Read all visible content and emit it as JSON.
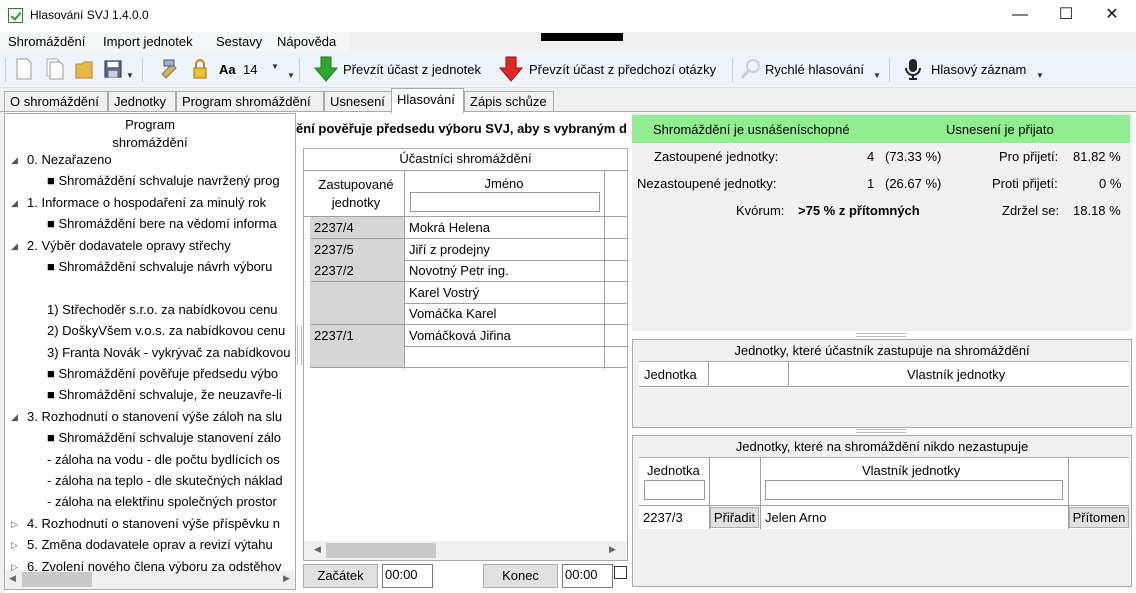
{
  "window": {
    "title": "Hlasování SVJ 1.4.0.0",
    "minimize_glyph": "—",
    "maximize_glyph": "☐",
    "close_glyph": "✕"
  },
  "menu": [
    "Shromáždění",
    "Import jednotek",
    "Sestavy",
    "Nápověda"
  ],
  "toolbar": {
    "font_label": "Aa",
    "font_size": "14",
    "take_over_label": "Převzít účast z jednotek",
    "take_prev_label": "Převzít účast z předchozí otázky",
    "quick_vote_label": "Rychlé hlasování",
    "voice_label": "Hlasový záznam"
  },
  "tabs": [
    "O shromáždění",
    "Jednotky",
    "Program shromáždění",
    "Usnesení",
    "Hlasování",
    "Zápis schůze"
  ],
  "program": {
    "header": "Program shromáždění",
    "items": [
      {
        "text": "0. Nezařazeno",
        "level": 0,
        "toggle": "◢"
      },
      {
        "text": "■ Shromáždění schvaluje navržený prog",
        "level": 1,
        "toggle": ""
      },
      {
        "text": "1. Informace o hospodaření za minulý rok",
        "level": 0,
        "toggle": "◢"
      },
      {
        "text": "■ Shromáždění bere na vědomí informa",
        "level": 1,
        "toggle": ""
      },
      {
        "text": "2. Výběr dodavatele opravy střechy",
        "level": 0,
        "toggle": "◢"
      },
      {
        "text": "■ Shromáždění schvaluje návrh výboru",
        "level": 1,
        "toggle": ""
      },
      {
        "text": "",
        "level": 1,
        "toggle": ""
      },
      {
        "text": "1) Střechoděr s.r.o. za nabídkovou cenu",
        "level": 1,
        "toggle": ""
      },
      {
        "text": "2) DoškyVšem v.o.s. za nabídkovou cenu",
        "level": 1,
        "toggle": ""
      },
      {
        "text": "3) Franta Novák - vykrývač za nabídkovou",
        "level": 1,
        "toggle": ""
      },
      {
        "text": "■ Shromáždění pověřuje předsedu výbo",
        "level": 1,
        "toggle": ""
      },
      {
        "text": "■ Shromáždění schvaluje, že neuzavře-li",
        "level": 1,
        "toggle": ""
      },
      {
        "text": "3. Rozhodnutí o stanovení výše záloh na slu",
        "level": 0,
        "toggle": "◢"
      },
      {
        "text": "■ Shromáždění schvaluje stanovení zálo",
        "level": 1,
        "toggle": ""
      },
      {
        "text": "- záloha na vodu - dle počtu bydlících os",
        "level": 1,
        "toggle": ""
      },
      {
        "text": "- záloha na teplo - dle skutečných náklad",
        "level": 1,
        "toggle": ""
      },
      {
        "text": "- záloha na elektřinu společných prostor",
        "level": 1,
        "toggle": ""
      },
      {
        "text": "4. Rozhodnutí o stanovení výše příspěvku n",
        "level": 0,
        "toggle": "▷"
      },
      {
        "text": "5. Změna dodavatele oprav a revizí výtahu",
        "level": 0,
        "toggle": "▷"
      },
      {
        "text": "6. Zvolení nového člena výboru za odstěhov",
        "level": 0,
        "toggle": "▷"
      }
    ]
  },
  "question_text": "ění pověřuje předsedu výboru SVJ, aby s vybraným d",
  "participants": {
    "title": "Účastníci shromáždění",
    "col_units": "Zastupované jednotky",
    "col_name": "Jméno",
    "rows": [
      {
        "unit": "2237/4",
        "name": "Mokrá Helena"
      },
      {
        "unit": "2237/5",
        "name": "Jiří z prodejny"
      },
      {
        "unit": "2237/2",
        "name": "Novotný Petr ing."
      },
      {
        "unit": "",
        "name": "Karel Vostrý"
      },
      {
        "unit": "",
        "name": "Vomáčka Karel"
      },
      {
        "unit": "2237/1",
        "name": "Vomáčková Jiřina"
      },
      {
        "unit": "",
        "name": ""
      }
    ]
  },
  "bottom": {
    "start_label": "Začátek",
    "start_time": "00:00",
    "end_label": "Konec",
    "end_time": "00:00"
  },
  "status": {
    "quorum_state": "Shromáždění je usnášeníschopné",
    "resolution_state": "Usnesení je přijato",
    "represented_label": "Zastoupené jednotky:",
    "represented_count": "4",
    "represented_pct": "(73.33 %)",
    "unrepresented_label": "Nezastoupené jednotky:",
    "unrepresented_count": "1",
    "unrepresented_pct": "(26.67 %)",
    "quorum_label": "Kvórum:",
    "quorum_value": ">75 % z přítomných",
    "for_label": "Pro přijetí:",
    "for_value": "81.82 %",
    "against_label": "Proti přijetí:",
    "against_value": "0 %",
    "abstain_label": "Zdržel se:",
    "abstain_value": "18.18 %",
    "banner_color": "#90ee90"
  },
  "represented_units": {
    "title": "Jednotky, které účastník zastupuje na shromáždění",
    "col_unit": "Jednotka",
    "col_owner": "Vlastník jednotky"
  },
  "unrepresented_units": {
    "title": "Jednotky, které na shromáždění nikdo nezastupuje",
    "col_unit": "Jednotka",
    "col_owner": "Vlastník jednotky",
    "rows": [
      {
        "unit": "2237/3",
        "assign_label": "Přiřadit",
        "owner": "Jelen Arno",
        "present_label": "Přítomen"
      }
    ]
  }
}
